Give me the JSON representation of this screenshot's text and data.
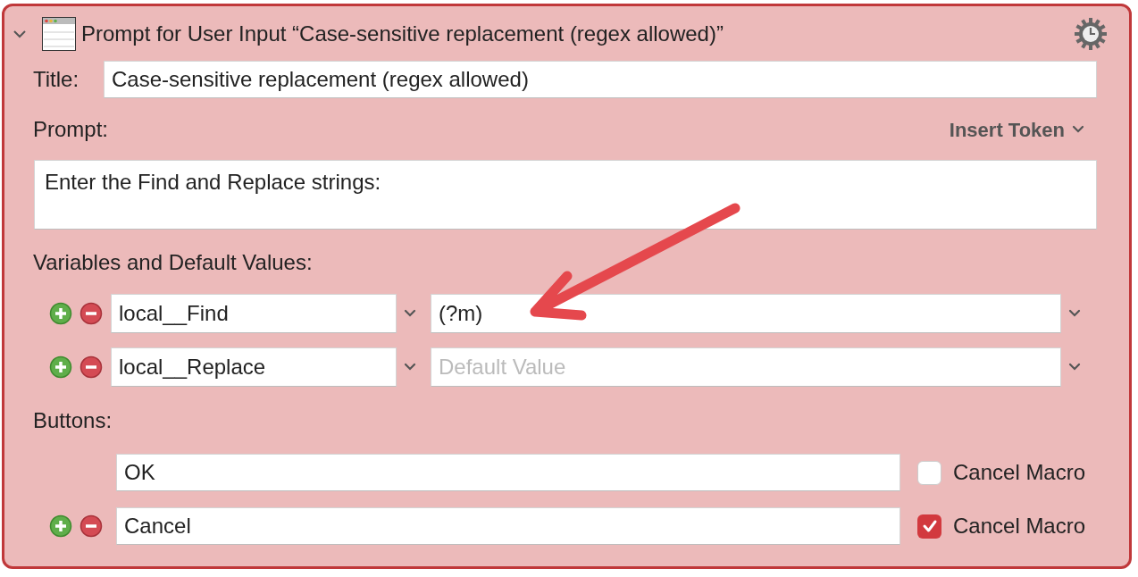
{
  "action": {
    "title": "Prompt for User Input “Case-sensitive replacement (regex allowed)”",
    "expanded": true
  },
  "title_field": {
    "label": "Title:",
    "value": "Case-sensitive replacement (regex allowed)"
  },
  "prompt": {
    "label": "Prompt:",
    "insert_token": "Insert Token",
    "value": "Enter the Find and Replace strings:"
  },
  "variables": {
    "label": "Variables and Default Values:",
    "rows": [
      {
        "name": "local__Find",
        "default_value": "(?m)"
      },
      {
        "name": "local__Replace",
        "placeholder": "Default Value"
      }
    ]
  },
  "buttons": {
    "label": "Buttons:",
    "rows": [
      {
        "label": "OK",
        "removable": false,
        "cancel_macro": false,
        "cancel_label": "Cancel Macro"
      },
      {
        "label": "Cancel",
        "removable": true,
        "cancel_macro": true,
        "cancel_label": "Cancel Macro"
      }
    ]
  }
}
